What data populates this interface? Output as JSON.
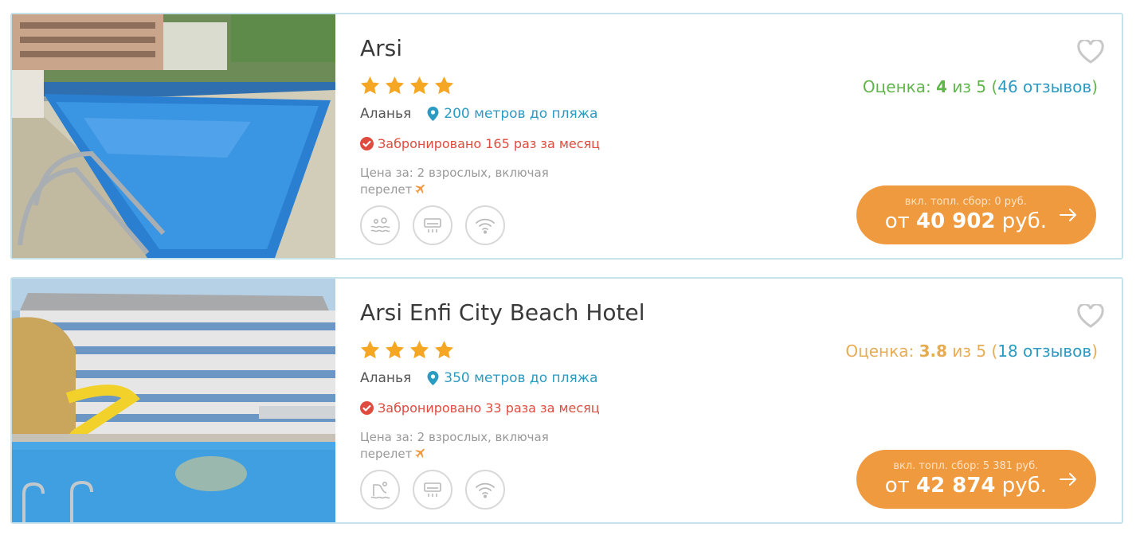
{
  "colors": {
    "rating_good": "#5fb54a",
    "rating_mid": "#e6ac52",
    "link_blue": "#2b9bc2",
    "booked_red": "#e04b3f",
    "price_button": "#f09a40",
    "star": "#f5a623",
    "card_border": "#c6e2ea"
  },
  "hotels": [
    {
      "name": "Arsi",
      "stars": 4,
      "city": "Аланья",
      "beach_distance": "200 метров до пляжа",
      "booked": "Забронировано 165 раз за месяц",
      "price_for": "Цена за: 2 взрослых, включая перелет",
      "amenities": [
        "spa-icon",
        "air-conditioner-icon",
        "wifi-icon"
      ],
      "rating": {
        "label": "Оценка:",
        "score": "4",
        "out_of": "из 5",
        "open": "(",
        "reviews": "46 отзывов",
        "close": ")"
      },
      "fee": "вкл. топл. сбор: 0 руб.",
      "price_prefix": "от",
      "price_value": "40 902",
      "price_currency": "руб."
    },
    {
      "name": "Arsi Enfi City Beach Hotel",
      "stars": 4,
      "city": "Аланья",
      "beach_distance": "350 метров до пляжа",
      "booked": "Забронировано 33 раза за месяц",
      "price_for": "Цена за: 2 взрослых, включая перелет",
      "amenities": [
        "water-slide-icon",
        "air-conditioner-icon",
        "wifi-icon"
      ],
      "rating": {
        "label": "Оценка:",
        "score": "3.8",
        "out_of": "из 5",
        "open": "(",
        "reviews": "18 отзывов",
        "close": ")"
      },
      "fee": "вкл. топл. сбор: 5 381 руб.",
      "price_prefix": "от",
      "price_value": "42 874",
      "price_currency": "руб."
    }
  ]
}
